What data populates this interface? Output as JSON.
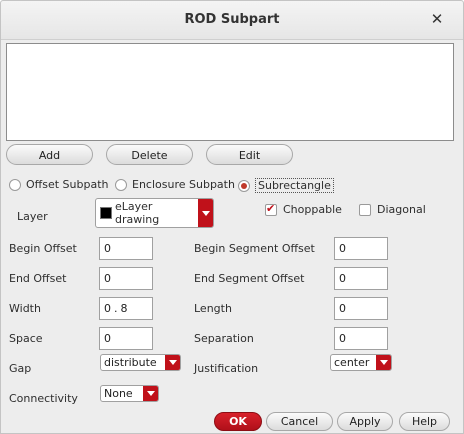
{
  "window": {
    "title": "ROD Subpart"
  },
  "buttons": {
    "add": "Add",
    "delete": "Delete",
    "edit": "Edit",
    "ok": "OK",
    "cancel": "Cancel",
    "apply": "Apply",
    "help": "Help"
  },
  "subpart_type": {
    "options": [
      "Offset Subpath",
      "Enclosure Subpath",
      "Subrectangle"
    ],
    "selected": "Subrectangle"
  },
  "layer": {
    "label": "Layer",
    "value": "eLayer drawing",
    "swatch_color": "#000000"
  },
  "choppable": {
    "label": "Choppable",
    "checked": true
  },
  "diagonal": {
    "label": "Diagonal",
    "checked": false
  },
  "fields": {
    "begin_offset": {
      "label": "Begin Offset",
      "value": "0"
    },
    "end_offset": {
      "label": "End Offset",
      "value": "0"
    },
    "width": {
      "label": "Width",
      "value": "0.8"
    },
    "space": {
      "label": "Space",
      "value": "0"
    },
    "begin_segment_offset": {
      "label": "Begin Segment Offset",
      "value": "0"
    },
    "end_segment_offset": {
      "label": "End Segment Offset",
      "value": "0"
    },
    "length": {
      "label": "Length",
      "value": "0"
    },
    "separation": {
      "label": "Separation",
      "value": "0"
    }
  },
  "gap": {
    "label": "Gap",
    "value": "distribute"
  },
  "justification": {
    "label": "Justification",
    "value": "center"
  },
  "connectivity": {
    "label": "Connectivity",
    "value": "None"
  },
  "colors": {
    "accent": "#c0111a",
    "radio_selected": "#c0392b"
  }
}
